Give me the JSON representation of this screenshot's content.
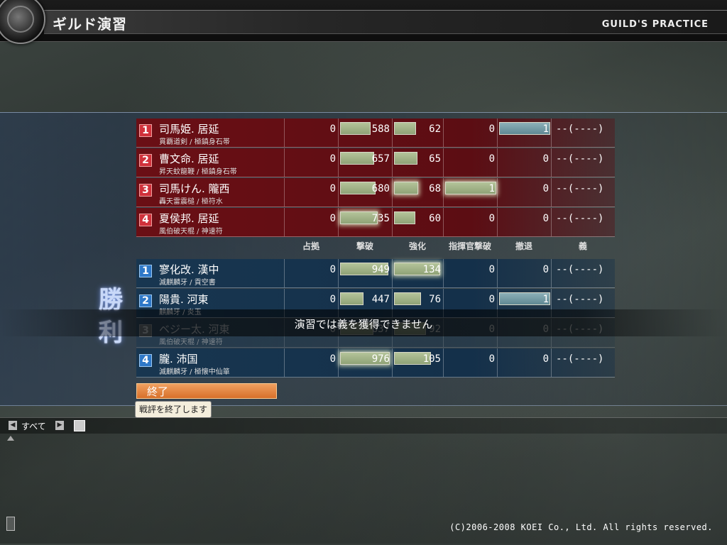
{
  "header": {
    "title": "ギルド演習",
    "title_en": "GUILD'S PRACTICE"
  },
  "columns": [
    "占拠",
    "撃破",
    "強化",
    "指揮官撃破",
    "撤退",
    "義"
  ],
  "red_team": [
    {
      "rank": "1",
      "name": "司馬姫. 居延",
      "weapons": "貫覇道剣 / 極鎮身石帯",
      "occupy": "0",
      "defeat": "588",
      "enhance": "62",
      "cmd_defeat": "0",
      "retreat": "1",
      "gi": "--(----)"
    },
    {
      "rank": "2",
      "name": "曹文命. 居延",
      "weapons": "昇天蚊龍鞭 / 極鎮身石帯",
      "occupy": "0",
      "defeat": "657",
      "enhance": "65",
      "cmd_defeat": "0",
      "retreat": "0",
      "gi": "--(----)"
    },
    {
      "rank": "3",
      "name": "司馬けん. 隴西",
      "weapons": "轟天雷震槌 / 極符水",
      "occupy": "0",
      "defeat": "680",
      "enhance": "68",
      "cmd_defeat": "1",
      "retreat": "0",
      "gi": "--(----)"
    },
    {
      "rank": "4",
      "name": "夏侯邦. 居延",
      "weapons": "風伯破天棍 / 神速符",
      "occupy": "0",
      "defeat": "735",
      "enhance": "60",
      "cmd_defeat": "0",
      "retreat": "0",
      "gi": "--(----)"
    }
  ],
  "blue_team": [
    {
      "rank": "1",
      "name": "寥化改. 漢中",
      "weapons": "滅麒麟牙 / 貢空書",
      "occupy": "0",
      "defeat": "949",
      "enhance": "134",
      "cmd_defeat": "0",
      "retreat": "0",
      "gi": "--(----)"
    },
    {
      "rank": "2",
      "name": "陽貴. 河東",
      "weapons": "麒麟牙 / 炎玉",
      "occupy": "0",
      "defeat": "447",
      "enhance": "76",
      "cmd_defeat": "0",
      "retreat": "1",
      "gi": "--(----)"
    },
    {
      "rank": "3",
      "name": "ベジー太. 河東",
      "weapons": "風伯破天棍 / 神速符",
      "occupy": "0",
      "defeat": "637",
      "enhance": "92",
      "cmd_defeat": "0",
      "retreat": "0",
      "gi": "--(----)"
    },
    {
      "rank": "4",
      "name": "朧. 沛国",
      "weapons": "滅麒麟牙 / 極懐中仙箪",
      "occupy": "0",
      "defeat": "976",
      "enhance": "105",
      "cmd_defeat": "0",
      "retreat": "0",
      "gi": "--(----)"
    }
  ],
  "result": {
    "victory_text": "勝利"
  },
  "notice": "演習では義を獲得できません",
  "end_button": {
    "label": "終了",
    "tooltip": "戦評を終了します"
  },
  "chat": {
    "tab_label": "すべて"
  },
  "copyright": "(C)2006-2008 KOEI Co., Ltd. All rights reserved."
}
